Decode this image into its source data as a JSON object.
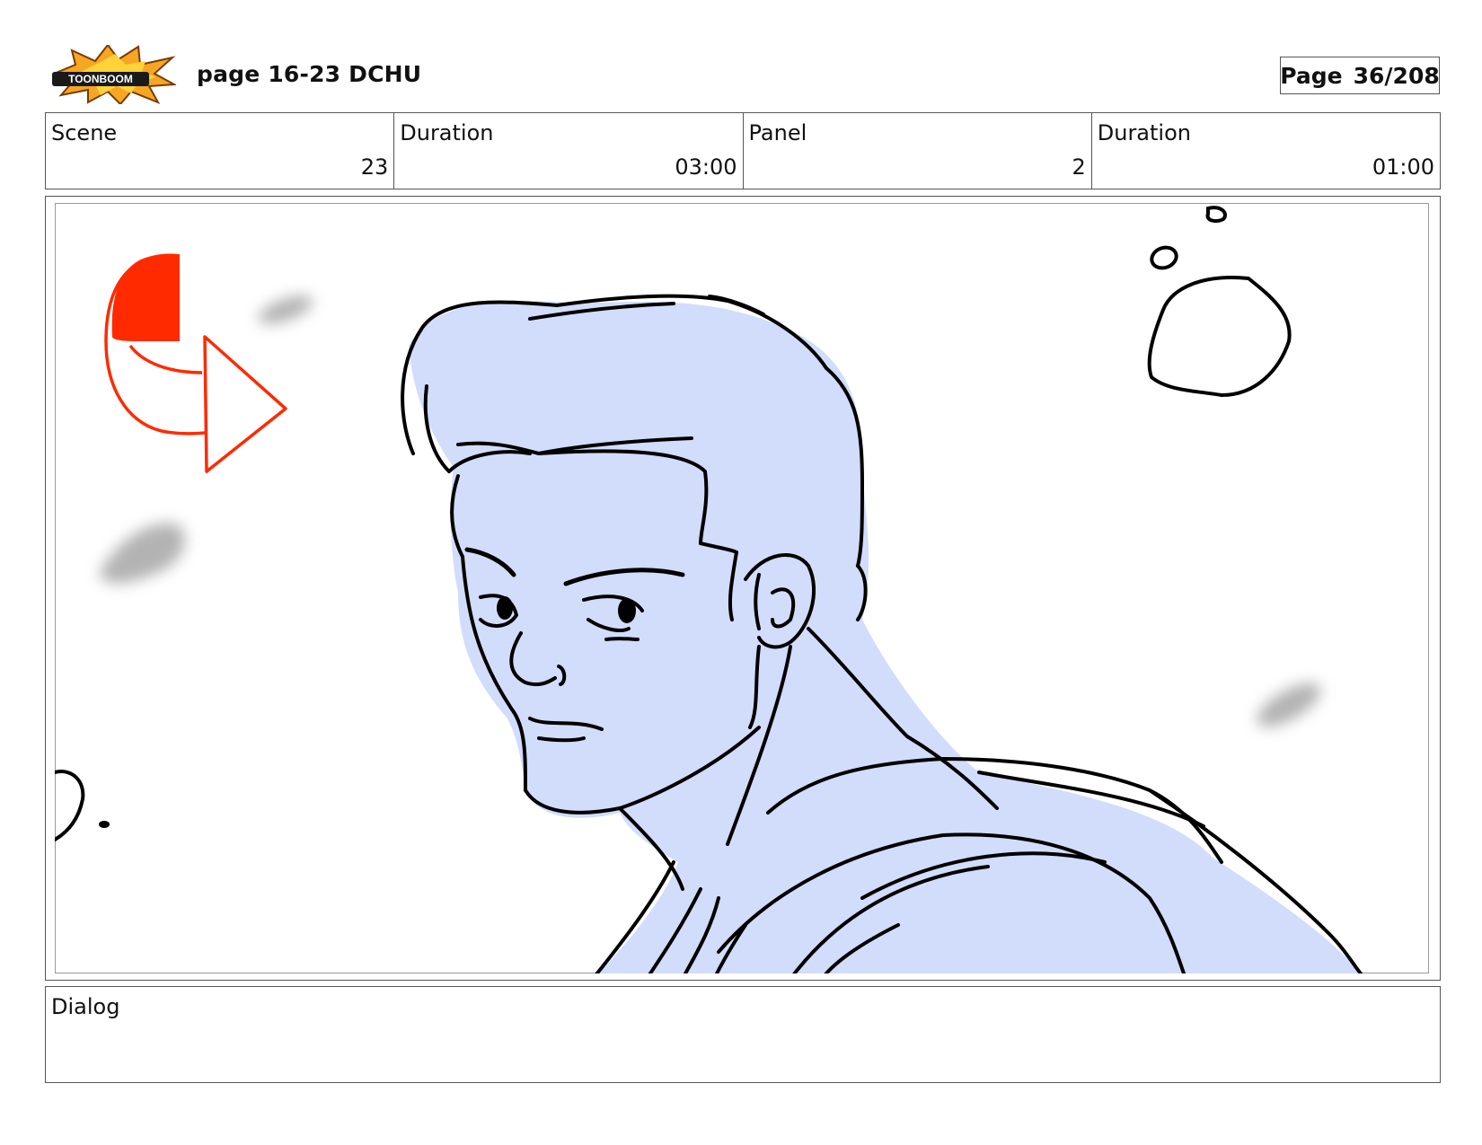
{
  "header": {
    "logo_text": "TOONBOOM",
    "title": "page 16-23 DCHU",
    "page_label": "Page",
    "page_number": "36/208"
  },
  "info": {
    "scene_label": "Scene",
    "scene_value": "23",
    "scene_duration_label": "Duration",
    "scene_duration_value": "03:00",
    "panel_label": "Panel",
    "panel_value": "2",
    "panel_duration_label": "Duration",
    "panel_duration_value": "01:00"
  },
  "dialog": {
    "label": "Dialog"
  },
  "colors": {
    "sketch_fill": "#d2dcfb",
    "camera_arrow": "#ff2a00",
    "logo_burst": "#f5a623"
  }
}
